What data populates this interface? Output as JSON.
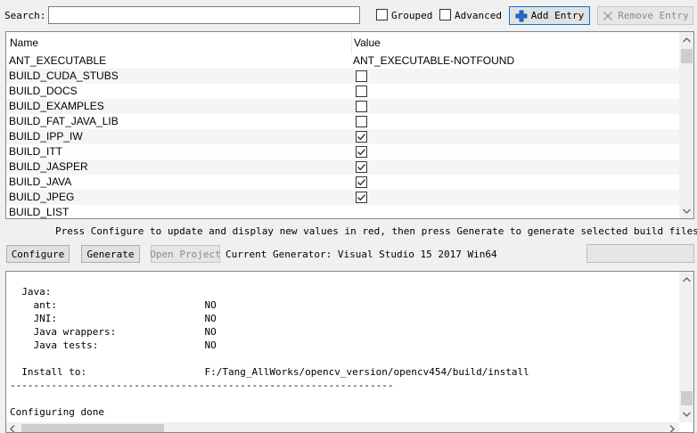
{
  "search": {
    "label": "Search:",
    "value": "",
    "placeholder": ""
  },
  "options": {
    "grouped": {
      "label": "Grouped",
      "checked": false
    },
    "advanced": {
      "label": "Advanced",
      "checked": false
    }
  },
  "buttons": {
    "add_entry": {
      "label": "Add Entry",
      "icon": "plus-icon",
      "enabled": true
    },
    "remove_entry": {
      "label": "Remove Entry",
      "icon": "x-icon",
      "enabled": false
    },
    "configure": {
      "label": "Configure"
    },
    "generate": {
      "label": "Generate"
    },
    "open_project": {
      "label": "Open Project",
      "enabled": false
    }
  },
  "table": {
    "columns": [
      "Name",
      "Value"
    ],
    "rows": [
      {
        "name": "ANT_EXECUTABLE",
        "type": "text",
        "value": "ANT_EXECUTABLE-NOTFOUND"
      },
      {
        "name": "BUILD_CUDA_STUBS",
        "type": "bool",
        "value": false
      },
      {
        "name": "BUILD_DOCS",
        "type": "bool",
        "value": false
      },
      {
        "name": "BUILD_EXAMPLES",
        "type": "bool",
        "value": false
      },
      {
        "name": "BUILD_FAT_JAVA_LIB",
        "type": "bool",
        "value": false
      },
      {
        "name": "BUILD_IPP_IW",
        "type": "bool",
        "value": true
      },
      {
        "name": "BUILD_ITT",
        "type": "bool",
        "value": true
      },
      {
        "name": "BUILD_JASPER",
        "type": "bool",
        "value": true
      },
      {
        "name": "BUILD_JAVA",
        "type": "bool",
        "value": true
      },
      {
        "name": "BUILD_JPEG",
        "type": "bool",
        "value": true
      },
      {
        "name": "BUILD_LIST",
        "type": "text",
        "value": ""
      }
    ]
  },
  "hint": "Press Configure to update and display new values in red, then press Generate to generate selected build files.",
  "generator": "Current Generator: Visual Studio 15 2017 Win64",
  "output": {
    "lines": [
      "  Java:",
      "    ant:                         NO",
      "    JNI:                         NO",
      "    Java wrappers:               NO",
      "    Java tests:                  NO",
      "",
      "  Install to:                    F:/Tang_AllWorks/opencv_version/opencv454/build/install",
      "-----------------------------------------------------------------",
      "",
      "Configuring done"
    ]
  },
  "colors": {
    "accent": "#0078d7",
    "check": "#333333"
  }
}
